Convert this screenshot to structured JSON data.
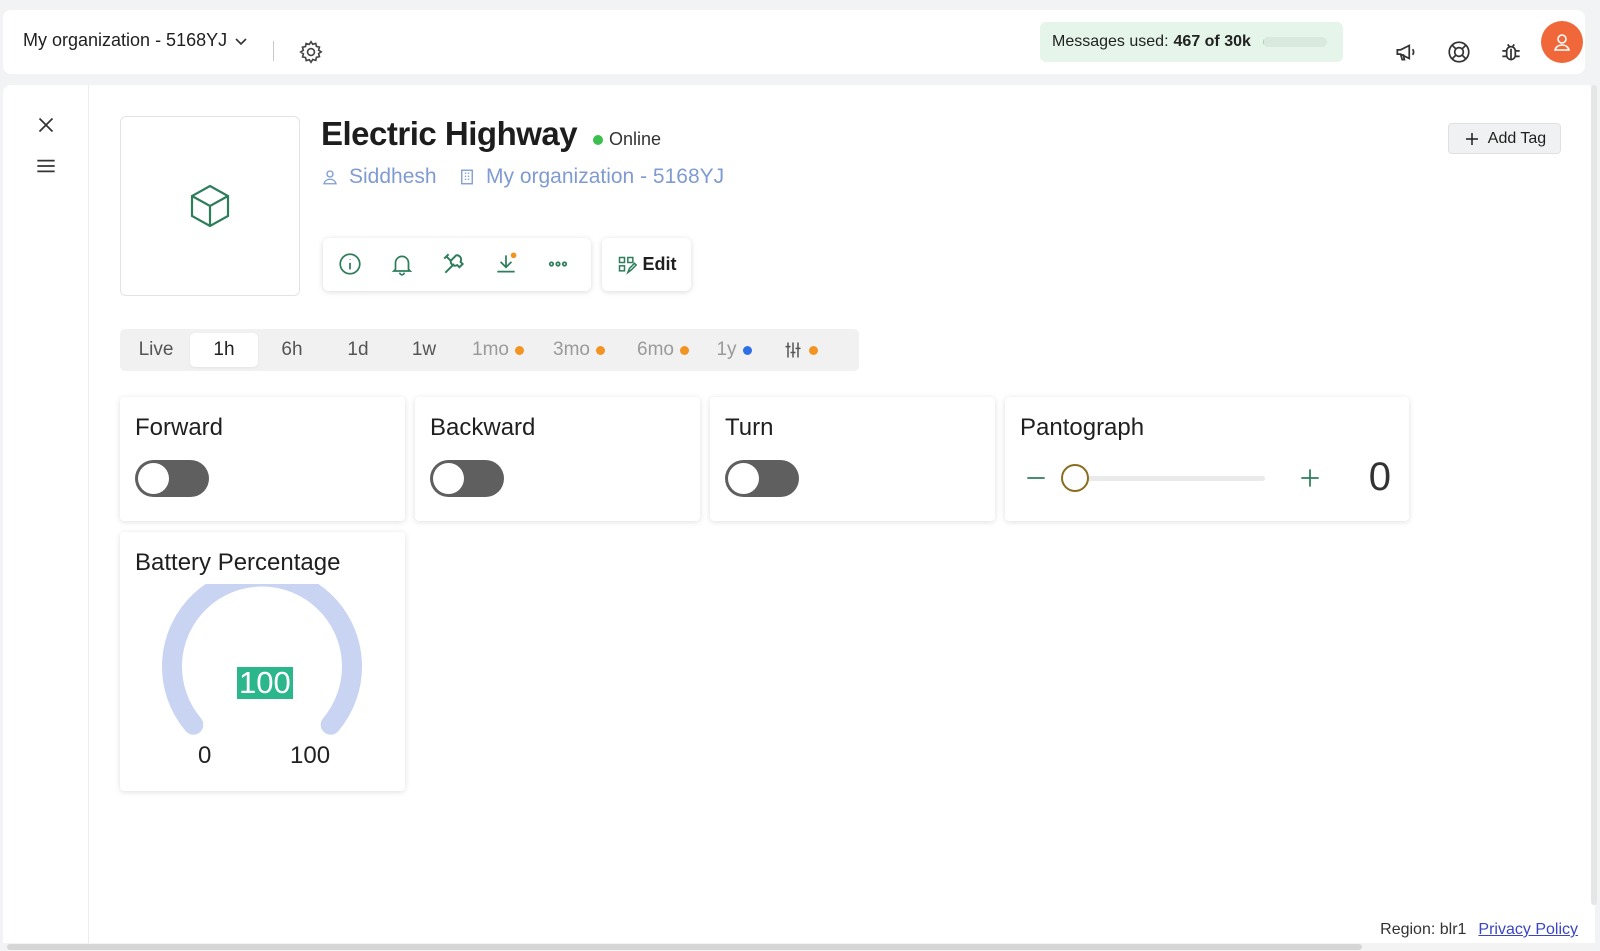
{
  "topbar": {
    "org_label": "My organization - 5168YJ",
    "messages_prefix": "Messages used:",
    "messages_count": "467 of 30k",
    "messages_used_fraction": 0.0156,
    "icons": [
      "chevron-down-icon",
      "gear-icon",
      "megaphone-icon",
      "lifebuoy-icon",
      "bug-icon",
      "user-avatar-icon"
    ]
  },
  "device": {
    "name": "Electric Highway",
    "status": "Online",
    "status_color": "#3bbf4e",
    "owner": "Siddhesh",
    "organization": "My organization - 5168YJ",
    "edit_label": "Edit",
    "add_tag_label": "Add Tag",
    "tools": [
      "info-icon",
      "bell-icon",
      "tools-icon",
      "download-icon",
      "more-icon"
    ]
  },
  "ranges": {
    "items": [
      {
        "label": "Live",
        "active": false,
        "dot": null
      },
      {
        "label": "1h",
        "active": true,
        "dot": null
      },
      {
        "label": "6h",
        "active": false,
        "dot": null
      },
      {
        "label": "1d",
        "active": false,
        "dot": null
      },
      {
        "label": "1w",
        "active": false,
        "dot": null
      },
      {
        "label": "1mo",
        "active": false,
        "dot": "#f29422"
      },
      {
        "label": "3mo",
        "active": false,
        "dot": "#f29422"
      },
      {
        "label": "6mo",
        "active": false,
        "dot": "#f29422"
      },
      {
        "label": "1y",
        "active": false,
        "dot": "#2f6fe6"
      }
    ],
    "settings_dot": "#f29422"
  },
  "widgets": {
    "forward": {
      "title": "Forward",
      "on": false
    },
    "backward": {
      "title": "Backward",
      "on": false
    },
    "turn": {
      "title": "Turn",
      "on": false
    },
    "pantograph": {
      "title": "Pantograph",
      "value": "0"
    },
    "battery": {
      "title": "Battery Percentage",
      "value": "100",
      "min": "0",
      "max": "100",
      "arc_color": "#c9d4f2",
      "value_color": "#2bb68c"
    }
  },
  "footer": {
    "region": "Region: blr1",
    "privacy": "Privacy Policy"
  }
}
